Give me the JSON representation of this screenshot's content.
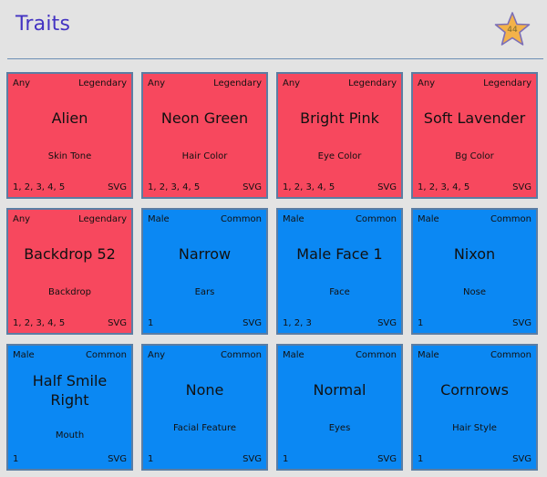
{
  "header": {
    "title": "Traits",
    "star_count": "44",
    "star_color": "#f3b24a"
  },
  "colors": {
    "legendary": "#f7485e",
    "common": "#0b88f3",
    "title": "#4333c2"
  },
  "traits": [
    {
      "gender": "Any",
      "rarity": "Legendary",
      "name": "Alien",
      "type": "Skin Tone",
      "versions": "1, 2, 3, 4, 5",
      "format": "SVG"
    },
    {
      "gender": "Any",
      "rarity": "Legendary",
      "name": "Neon Green",
      "type": "Hair Color",
      "versions": "1, 2, 3, 4, 5",
      "format": "SVG"
    },
    {
      "gender": "Any",
      "rarity": "Legendary",
      "name": "Bright Pink",
      "type": "Eye Color",
      "versions": "1, 2, 3, 4, 5",
      "format": "SVG"
    },
    {
      "gender": "Any",
      "rarity": "Legendary",
      "name": "Soft Lavender",
      "type": "Bg Color",
      "versions": "1, 2, 3, 4, 5",
      "format": "SVG"
    },
    {
      "gender": "Any",
      "rarity": "Legendary",
      "name": "Backdrop 52",
      "type": "Backdrop",
      "versions": "1, 2, 3, 4, 5",
      "format": "SVG"
    },
    {
      "gender": "Male",
      "rarity": "Common",
      "name": "Narrow",
      "type": "Ears",
      "versions": "1",
      "format": "SVG"
    },
    {
      "gender": "Male",
      "rarity": "Common",
      "name": "Male Face 1",
      "type": "Face",
      "versions": "1, 2, 3",
      "format": "SVG"
    },
    {
      "gender": "Male",
      "rarity": "Common",
      "name": "Nixon",
      "type": "Nose",
      "versions": "1",
      "format": "SVG"
    },
    {
      "gender": "Male",
      "rarity": "Common",
      "name": "Half Smile Right",
      "type": "Mouth",
      "versions": "1",
      "format": "SVG"
    },
    {
      "gender": "Any",
      "rarity": "Common",
      "name": "None",
      "type": "Facial Feature",
      "versions": "1",
      "format": "SVG"
    },
    {
      "gender": "Male",
      "rarity": "Common",
      "name": "Normal",
      "type": "Eyes",
      "versions": "1",
      "format": "SVG"
    },
    {
      "gender": "Male",
      "rarity": "Common",
      "name": "Cornrows",
      "type": "Hair Style",
      "versions": "1",
      "format": "SVG"
    }
  ]
}
